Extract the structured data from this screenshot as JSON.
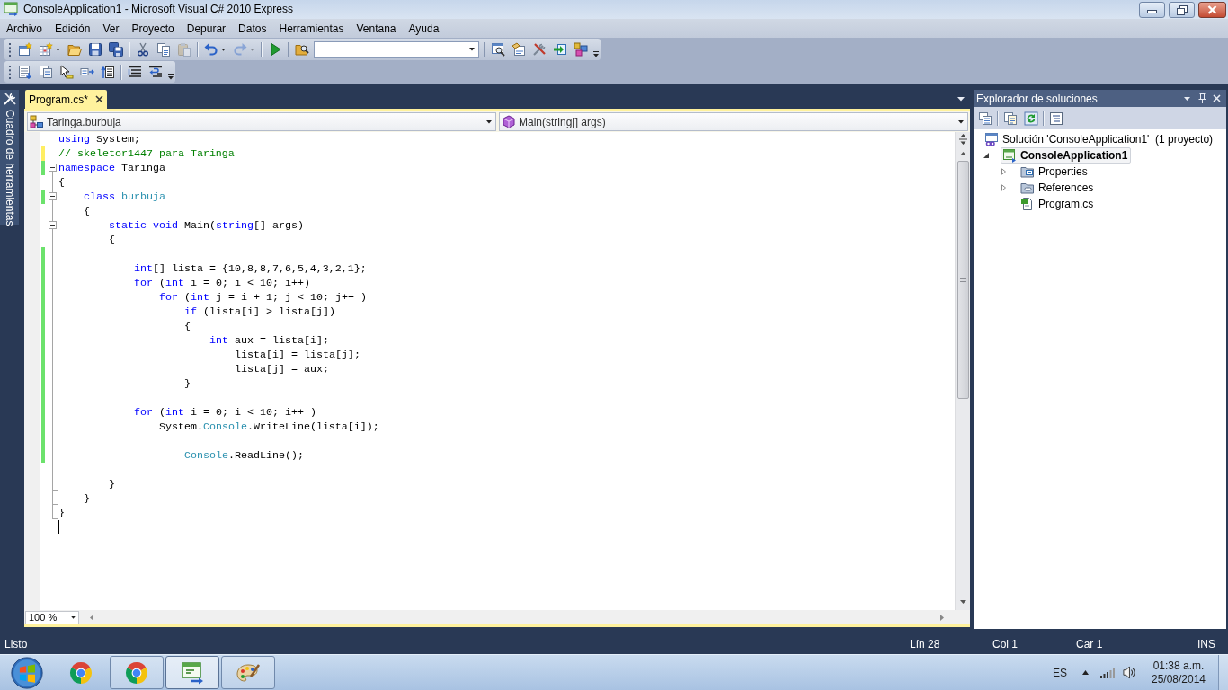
{
  "window": {
    "title": "ConsoleApplication1 - Microsoft Visual C# 2010 Express"
  },
  "menu": [
    "Archivo",
    "Edición",
    "Ver",
    "Proyecto",
    "Depurar",
    "Datos",
    "Herramientas",
    "Ventana",
    "Ayuda"
  ],
  "toolbars": [
    {
      "groups": [
        {
          "buttons": [
            {
              "kind": "new-project",
              "disabled": false
            },
            {
              "kind": "add-item",
              "disabled": false,
              "menu": true
            },
            {
              "kind": "open",
              "disabled": false
            },
            {
              "kind": "save",
              "disabled": false
            },
            {
              "kind": "save-all",
              "disabled": false
            }
          ]
        },
        {
          "buttons": [
            {
              "kind": "cut",
              "disabled": false
            },
            {
              "kind": "copy",
              "disabled": false
            },
            {
              "kind": "paste",
              "disabled": true
            }
          ]
        },
        {
          "buttons": [
            {
              "kind": "undo",
              "disabled": false,
              "menu": true
            },
            {
              "kind": "redo",
              "disabled": true,
              "menu": true
            }
          ]
        },
        {
          "buttons": [
            {
              "kind": "start",
              "disabled": false
            }
          ]
        },
        {
          "buttons": [
            {
              "kind": "find-in-files",
              "disabled": false
            },
            {
              "kind": "combo",
              "disabled": false
            }
          ]
        },
        {
          "buttons": [
            {
              "kind": "find-symbol",
              "disabled": false
            },
            {
              "kind": "properties",
              "disabled": false
            },
            {
              "kind": "tools",
              "disabled": false
            },
            {
              "kind": "export",
              "disabled": false
            },
            {
              "kind": "windows",
              "disabled": false
            }
          ]
        }
      ]
    },
    {
      "groups": [
        {
          "buttons": [
            {
              "kind": "member-list",
              "disabled": false
            },
            {
              "kind": "parameter-info",
              "disabled": false
            },
            {
              "kind": "quick-info",
              "disabled": false
            },
            {
              "kind": "complete-word",
              "disabled": false
            },
            {
              "kind": "bookmark",
              "disabled": false
            }
          ]
        },
        {
          "buttons": [
            {
              "kind": "comment",
              "disabled": false
            },
            {
              "kind": "uncomment",
              "disabled": false
            }
          ]
        }
      ]
    }
  ],
  "toolbox_tab": {
    "label": "Cuadro de herramientas"
  },
  "document_tabs": [
    {
      "label": "Program.cs*",
      "selected": true
    }
  ],
  "navigation_bar": {
    "types": "Taringa.burbuja",
    "members": "Main(string[] args)"
  },
  "editor": {
    "lines": [
      {
        "segments": [
          {
            "kind": "keyword",
            "text": "using"
          },
          {
            "kind": "plain",
            "text": " System;"
          }
        ]
      },
      {
        "segments": [
          {
            "kind": "comment",
            "text": "// skeletor1447 para Taringa"
          }
        ],
        "color": "#ffee62"
      },
      {
        "segments": [
          {
            "kind": "keyword",
            "text": "namespace"
          },
          {
            "kind": "plain",
            "text": " Taringa"
          }
        ],
        "color": "#6ce26c",
        "expanded": true
      },
      {
        "segments": [
          {
            "kind": "plain",
            "text": "{"
          }
        ]
      },
      {
        "segments": [
          {
            "kind": "keyword",
            "text": "    class"
          },
          {
            "kind": "type",
            "text": " burbuja"
          }
        ],
        "color": "#6ce26c",
        "expanded": true
      },
      {
        "segments": [
          {
            "kind": "plain",
            "text": "    {"
          }
        ]
      },
      {
        "segments": [
          {
            "kind": "keyword",
            "text": "        static void"
          },
          {
            "kind": "plain",
            "text": " Main("
          },
          {
            "kind": "keyword",
            "text": "string"
          },
          {
            "kind": "plain",
            "text": "[] args)"
          }
        ],
        "expanded": true
      },
      {
        "segments": [
          {
            "kind": "plain",
            "text": "        {"
          }
        ]
      },
      {
        "color": "#6ce26c"
      },
      {
        "segments": [
          {
            "kind": "keyword",
            "text": "            int"
          },
          {
            "kind": "plain",
            "text": "[] lista = {10,8,8,7,6,5,4,3,2,1};"
          }
        ],
        "color": "#6ce26c"
      },
      {
        "segments": [
          {
            "kind": "keyword",
            "text": "            for"
          },
          {
            "kind": "plain",
            "text": " ("
          },
          {
            "kind": "keyword",
            "text": "int"
          },
          {
            "kind": "plain",
            "text": " i = 0; i < 10; i++)"
          }
        ],
        "color": "#6ce26c"
      },
      {
        "segments": [
          {
            "kind": "keyword",
            "text": "                for"
          },
          {
            "kind": "plain",
            "text": " ("
          },
          {
            "kind": "keyword",
            "text": "int"
          },
          {
            "kind": "plain",
            "text": " j = i + 1; j < 10; j++ )"
          }
        ],
        "color": "#6ce26c"
      },
      {
        "segments": [
          {
            "kind": "keyword",
            "text": "                    if"
          },
          {
            "kind": "plain",
            "text": " (lista[i] > lista[j])"
          }
        ],
        "color": "#6ce26c"
      },
      {
        "segments": [
          {
            "kind": "plain",
            "text": "                    {"
          }
        ],
        "color": "#6ce26c"
      },
      {
        "segments": [
          {
            "kind": "keyword",
            "text": "                        int"
          },
          {
            "kind": "plain",
            "text": " aux = lista[i];"
          }
        ],
        "color": "#6ce26c"
      },
      {
        "segments": [
          {
            "kind": "plain",
            "text": "                            lista[i] = lista[j];"
          }
        ],
        "color": "#6ce26c"
      },
      {
        "segments": [
          {
            "kind": "plain",
            "text": "                            lista[j] = aux;"
          }
        ],
        "color": "#6ce26c"
      },
      {
        "segments": [
          {
            "kind": "plain",
            "text": "                    }"
          }
        ],
        "color": "#6ce26c"
      },
      {
        "color": "#6ce26c"
      },
      {
        "segments": [
          {
            "kind": "keyword",
            "text": "            for"
          },
          {
            "kind": "plain",
            "text": " ("
          },
          {
            "kind": "keyword",
            "text": "int"
          },
          {
            "kind": "plain",
            "text": " i = 0; i < 10; i++ )"
          }
        ],
        "color": "#6ce26c"
      },
      {
        "segments": [
          {
            "kind": "plain",
            "text": "                System."
          },
          {
            "kind": "type",
            "text": "Console"
          },
          {
            "kind": "plain",
            "text": ".WriteLine(lista[i]);"
          }
        ],
        "color": "#6ce26c"
      },
      {
        "color": "#6ce26c"
      },
      {
        "segments": [
          {
            "kind": "type",
            "text": "                    Console"
          },
          {
            "kind": "plain",
            "text": ".ReadLine();"
          }
        ],
        "color": "#6ce26c"
      },
      {
        "segments": [
          {
            "kind": "plain",
            "text": "        }"
          }
        ],
        "blank_before": true
      },
      {
        "segments": [
          {
            "kind": "plain",
            "text": "    }"
          }
        ]
      },
      {
        "segments": [
          {
            "kind": "plain",
            "text": "}"
          }
        ]
      },
      {
        "caret": true
      }
    ],
    "zoom": "100 %"
  },
  "solution_explorer": {
    "title": "Explorador de soluciones",
    "toolbar": {
      "groups": [
        {
          "buttons": [
            {
              "kind": "show-all-files",
              "disabled": false
            }
          ]
        },
        {
          "buttons": [
            {
              "kind": "properties-page",
              "disabled": false
            },
            {
              "kind": "refresh",
              "disabled": false
            }
          ]
        },
        {
          "buttons": [
            {
              "kind": "view-code",
              "disabled": false
            }
          ]
        }
      ]
    },
    "tree": [
      {
        "kind": "solution",
        "label": "Solución 'ConsoleApplication1'  (1 proyecto)",
        "selected": false,
        "children": [
          {
            "kind": "project",
            "label": "ConsoleApplication1",
            "selected": true,
            "expanded": true,
            "children": [
              {
                "kind": "properties-folder",
                "label": "Properties",
                "selected": false,
                "expanded": false
              },
              {
                "kind": "references-folder",
                "label": "References",
                "selected": false,
                "expanded": false
              },
              {
                "kind": "code-file",
                "label": "Program.cs",
                "selected": false
              }
            ]
          }
        ]
      }
    ]
  },
  "status_bar": {
    "message": "Listo",
    "line": "Lín 28",
    "column": "Col 1",
    "character": "Car 1",
    "mode": "INS"
  },
  "taskbar": {
    "apps": [
      {
        "kind": "browser",
        "running": false,
        "selected": false
      },
      {
        "kind": "browser",
        "running": true,
        "selected": false
      },
      {
        "kind": "csharp",
        "running": true,
        "selected": true
      },
      {
        "kind": "paint",
        "running": true,
        "selected": false
      }
    ],
    "language": "ES",
    "time": "01:38 a.m.",
    "date": "25/08/2014"
  }
}
